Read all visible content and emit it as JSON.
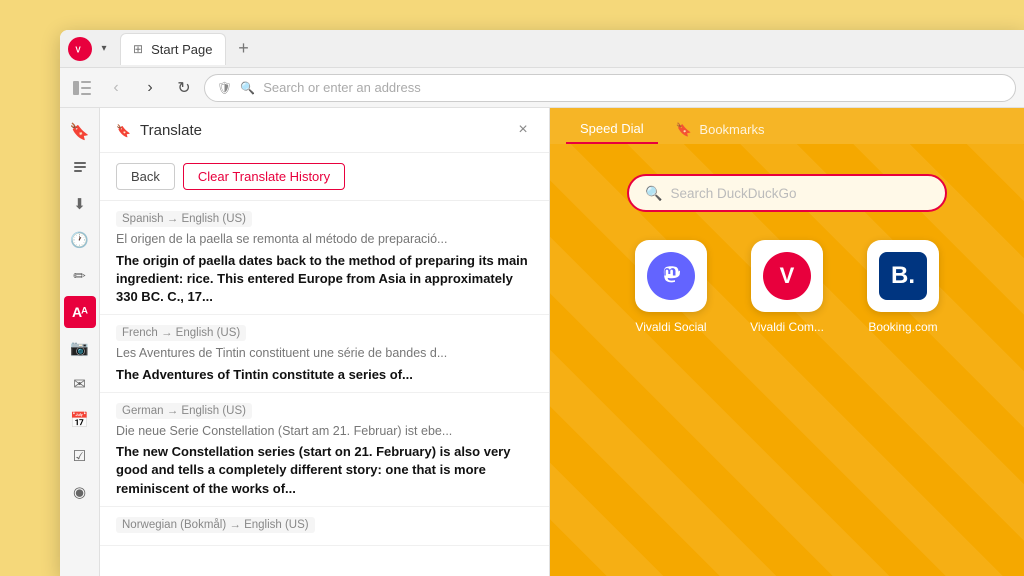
{
  "browser": {
    "tab_label": "Start Page",
    "new_tab_symbol": "+",
    "address_placeholder": "Search or enter an address"
  },
  "translate_panel": {
    "title": "Translate",
    "close_symbol": "×",
    "back_label": "Back",
    "clear_label": "Clear Translate History"
  },
  "history_items": [
    {
      "lang": "Spanish → English (US)",
      "original": "El origen de la paella se remonta al método de preparació...",
      "translated": "The origin of paella dates back to the method of preparing its main ingredient: rice. This entered Europe from Asia in approximately 330 BC. C., 17..."
    },
    {
      "lang": "French → English (US)",
      "original": "Les Aventures de Tintin constituent une série de bandes d...",
      "translated": "The Adventures of Tintin constitute a series of..."
    },
    {
      "lang": "German → English (US)",
      "original": "Die neue Serie Constellation (Start am 21. Februar) ist ebe...",
      "translated": "The new Constellation series (start on 21. February) is also very good and tells a completely different story: one that is more reminiscent of the works of..."
    },
    {
      "lang": "Norwegian (Bokmål) → English (US)",
      "original": "",
      "translated": ""
    }
  ],
  "speed_dial": {
    "tab_active": "Speed Dial",
    "tab_inactive": "Bookmarks"
  },
  "search": {
    "placeholder": "Search DuckDuckGo"
  },
  "dial_items": [
    {
      "label": "Vivaldi Social",
      "type": "mastodon"
    },
    {
      "label": "Vivaldi Com...",
      "type": "vivaldi"
    },
    {
      "label": "Booking.com",
      "type": "booking"
    }
  ],
  "sidebar_icons": [
    {
      "name": "bookmarks",
      "symbol": "🔖",
      "active": false
    },
    {
      "name": "reading-list",
      "symbol": "📋",
      "active": false
    },
    {
      "name": "downloads",
      "symbol": "⬇",
      "active": false
    },
    {
      "name": "history",
      "symbol": "🕐",
      "active": false
    },
    {
      "name": "notes",
      "symbol": "✏",
      "active": false
    },
    {
      "name": "translate",
      "symbol": "A",
      "active": true
    },
    {
      "name": "captures",
      "symbol": "🎬",
      "active": false
    },
    {
      "name": "mail",
      "symbol": "✉",
      "active": false
    },
    {
      "name": "calendar",
      "symbol": "📅",
      "active": false
    },
    {
      "name": "tasks",
      "symbol": "✓",
      "active": false
    },
    {
      "name": "feeds",
      "symbol": "◉",
      "active": false
    }
  ]
}
